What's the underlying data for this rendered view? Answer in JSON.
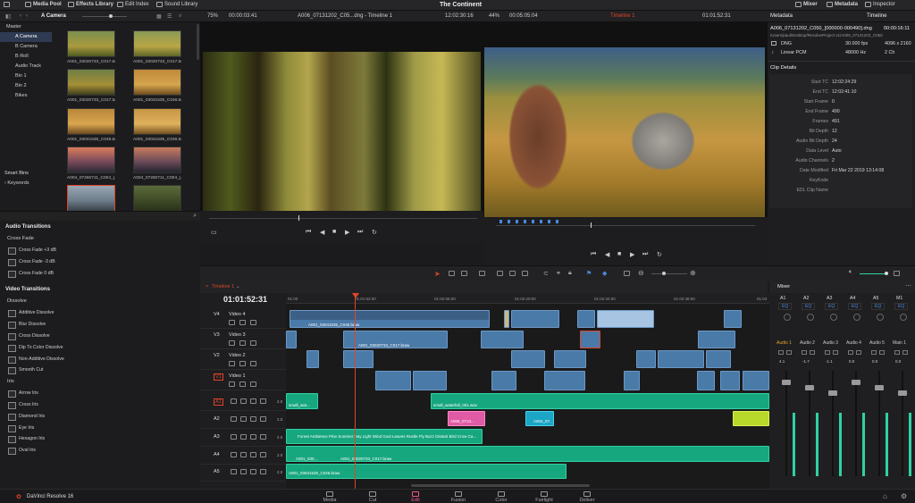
{
  "app": {
    "title": "The Continent",
    "name": "DaVinci Resolve 16"
  },
  "topbar": {
    "media_pool": "Media Pool",
    "effects_library": "Effects Library",
    "edit_index": "Edit Index",
    "sound_library": "Sound Library",
    "mixer": "Mixer",
    "metadata": "Metadata",
    "inspector": "Inspector"
  },
  "subbar": {
    "bin_name": "A Camera",
    "source_zoom": "75%",
    "source_tc": "00:00:03:41",
    "source_clip": "A006_07131202_C05...dng - Timeline 1",
    "source_time": "12:02:30:16",
    "timeline_zoom": "44%",
    "timeline_tc": "00:05:05:04",
    "timeline_name": "Timeline 1",
    "timeline_time": "01:01:52:31",
    "metadata_label": "Metadata",
    "metadata_timeline": "Timeline"
  },
  "media_pool": {
    "bins": [
      {
        "label": "Master"
      },
      {
        "label": "A Camera"
      },
      {
        "label": "B Camera"
      },
      {
        "label": "B Roll"
      },
      {
        "label": "Audio Track"
      },
      {
        "label": "Bin 1"
      },
      {
        "label": "Bin 2"
      },
      {
        "label": "Bikes"
      }
    ],
    "smart_bins": "Smart Bins",
    "keywords": "Keywords",
    "thumbs": [
      {
        "cap": "A001_03020733_C017.br..."
      },
      {
        "cap": "A001_03020733_C017.br..."
      },
      {
        "cap": "A001_03020733_C017.br..."
      },
      {
        "cap": "A001_03041535_C046.br..."
      },
      {
        "cap": "A001_03041535_C046.br..."
      },
      {
        "cap": "A001_03041535_C046.br..."
      },
      {
        "cap": "A004_07260711_C004_[..."
      },
      {
        "cap": "A004_07260711_C004_[..."
      },
      {
        "cap": "A006_07131202_C05...dng"
      },
      {
        "cap": "A006_07131202_C05...dng"
      }
    ]
  },
  "effects": {
    "audio_transitions": "Audio Transitions",
    "cross_fade": "Cross Fade",
    "audio_items": [
      "Cross Fade +3 dB",
      "Cross Fade -3 dB",
      "Cross Fade 0 dB"
    ],
    "video_transitions": "Video Transitions",
    "dissolve": "Dissolve",
    "dissolve_items": [
      "Additive Dissolve",
      "Blur Dissolve",
      "Cross Dissolve",
      "Dip To Color Dissolve",
      "Non-Additive Dissolve",
      "Smooth Cut"
    ],
    "iris": "Iris",
    "iris_items": [
      "Arrow Iris",
      "Cross Iris",
      "Diamond Iris",
      "Eye Iris",
      "Hexagon Iris",
      "Oval Iris"
    ]
  },
  "metadata": {
    "file": "A006_07131202_C050_[000000-000490].dng",
    "duration": "00:00:16:11",
    "path": "/Users/paul/Desktop/ResolveProject v1/A006_07131202_C050",
    "format": "DNG",
    "fps": "30.000 fps",
    "resolution": "4096 x 2160",
    "audio_codec": "Linear PCM",
    "sample_rate": "48000 Hz",
    "channels": "2 Ch",
    "clip_details": "Clip Details",
    "details": [
      {
        "k": "Start TC",
        "v": "12:02:24:29"
      },
      {
        "k": "End TC",
        "v": "12:02:41:10"
      },
      {
        "k": "Start Frame",
        "v": "0"
      },
      {
        "k": "End Frame",
        "v": "490"
      },
      {
        "k": "Frames",
        "v": "491"
      },
      {
        "k": "Bit Depth",
        "v": "12"
      },
      {
        "k": "Audio Bit Depth",
        "v": "24"
      },
      {
        "k": "Data Level",
        "v": "Auto"
      },
      {
        "k": "Audio Channels",
        "v": "2"
      },
      {
        "k": "Date Modified",
        "v": "Fri Mar 22 2019 13:14:08"
      },
      {
        "k": "KeyKode",
        "v": ""
      },
      {
        "k": "EDL Clip Name",
        "v": ""
      }
    ]
  },
  "timeline": {
    "tab": "Timeline 1",
    "timecode": "01:01:52:31",
    "ruler": [
      "01:00",
      "01:01:52:00",
      "01:02:06:00",
      "01:02:20:00",
      "01:02:34:00",
      "01:02:48:00",
      "01:03"
    ],
    "tracks": [
      {
        "id": "V4",
        "name": "Video 4"
      },
      {
        "id": "V3",
        "name": "Video 3"
      },
      {
        "id": "V2",
        "name": "Video 2"
      },
      {
        "id": "V1",
        "name": "Video 1"
      },
      {
        "id": "A1",
        "name": "",
        "vol": "2.0"
      },
      {
        "id": "A2",
        "name": "",
        "vol": "2.0"
      },
      {
        "id": "A3",
        "name": "",
        "vol": "2.0"
      },
      {
        "id": "A4",
        "name": "",
        "vol": "2.0"
      },
      {
        "id": "A5",
        "name": "",
        "vol": "2.0"
      }
    ],
    "clip_labels": {
      "v4a": "A001_03041535_C046.braw",
      "v3a": "A001_03020733_C017.braw",
      "a1a": "small_wat...",
      "a1b": "small_waterfall_001.wav",
      "a2a": "A006_0713...",
      "a2b": "A004_07...",
      "a3a": "Forest Ambience Pine Summer Day Light Wind Gust Leaves Rustle Fly Buzz Distant Bird Crow Ca...",
      "a4a": "A001_030...",
      "a4b": "A001_03020733_C017.braw",
      "a5a": "A001_03041535_C046.braw"
    }
  },
  "mixer": {
    "title": "Mixer",
    "channels": [
      "A1",
      "A2",
      "A3",
      "A4",
      "A5",
      "M1"
    ],
    "eq": "EQ",
    "labels": [
      "Audio 1",
      "Audio 2",
      "Audio 3",
      "Audio 4",
      "Audio 5",
      "Main 1"
    ],
    "levels": [
      "4.1",
      "-1.7",
      "-1.1",
      "0.0",
      "0.0",
      "0.0"
    ]
  },
  "pages": [
    {
      "label": "Media"
    },
    {
      "label": "Cut"
    },
    {
      "label": "Edit"
    },
    {
      "label": "Fusion"
    },
    {
      "label": "Color"
    },
    {
      "label": "Fairlight"
    },
    {
      "label": "Deliver"
    }
  ],
  "colors": {
    "accent": "#e85a80",
    "video_clip": "#4a7aa8",
    "audio_clip": "#17a77f",
    "playhead": "#e0442a"
  }
}
